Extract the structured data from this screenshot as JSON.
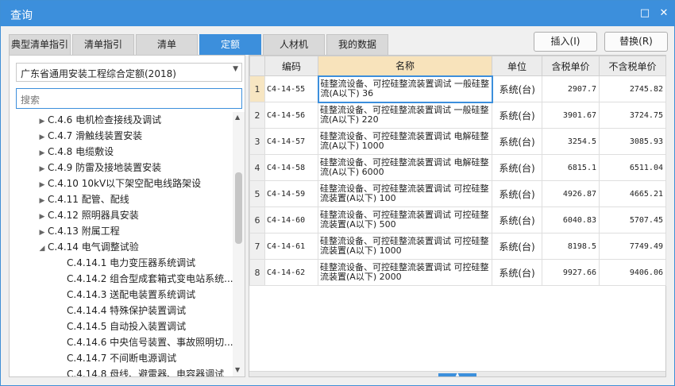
{
  "window": {
    "title": "查询",
    "minimize_glyph": "□",
    "close_glyph": "✕"
  },
  "tabs": [
    {
      "label": "典型清单指引",
      "active": false
    },
    {
      "label": "清单指引",
      "active": false
    },
    {
      "label": "清单",
      "active": false
    },
    {
      "label": "定额",
      "active": true
    },
    {
      "label": "人材机",
      "active": false
    },
    {
      "label": "我的数据",
      "active": false
    }
  ],
  "actions": {
    "insert_label": "插入(I)",
    "replace_label": "替换(R)"
  },
  "left": {
    "library": "广东省通用安装工程综合定额(2018)",
    "search_placeholder": "搜索",
    "tree": [
      {
        "label": "C.4.6 电机检查接线及调试",
        "level": 1,
        "toggle": "▶"
      },
      {
        "label": "C.4.7 滑触线装置安装",
        "level": 1,
        "toggle": "▶"
      },
      {
        "label": "C.4.8 电缆敷设",
        "level": 1,
        "toggle": "▶"
      },
      {
        "label": "C.4.9 防雷及接地装置安装",
        "level": 1,
        "toggle": "▶"
      },
      {
        "label": "C.4.10 10kV以下架空配电线路架设",
        "level": 1,
        "toggle": "▶"
      },
      {
        "label": "C.4.11 配管、配线",
        "level": 1,
        "toggle": "▶"
      },
      {
        "label": "C.4.12 照明器具安装",
        "level": 1,
        "toggle": "▶"
      },
      {
        "label": "C.4.13 附属工程",
        "level": 1,
        "toggle": "▶"
      },
      {
        "label": "C.4.14 电气调整试验",
        "level": 1,
        "toggle": "◢"
      },
      {
        "label": "C.4.14.1 电力变压器系统调试",
        "level": 2,
        "toggle": ""
      },
      {
        "label": "C.4.14.2 组合型成套箱式变电站系统...",
        "level": 2,
        "toggle": ""
      },
      {
        "label": "C.4.14.3 送配电装置系统调试",
        "level": 2,
        "toggle": ""
      },
      {
        "label": "C.4.14.4 特殊保护装置调试",
        "level": 2,
        "toggle": ""
      },
      {
        "label": "C.4.14.5 自动投入装置调试",
        "level": 2,
        "toggle": ""
      },
      {
        "label": "C.4.14.6 中央信号装置、事故照明切...",
        "level": 2,
        "toggle": ""
      },
      {
        "label": "C.4.14.7 不间断电源调试",
        "level": 2,
        "toggle": ""
      },
      {
        "label": "C.4.14.8 母线、避雷器、电容器调试",
        "level": 2,
        "toggle": ""
      }
    ]
  },
  "grid": {
    "columns": [
      "",
      "编码",
      "名称",
      "单位",
      "含税单价",
      "不含税单价"
    ],
    "rows": [
      {
        "n": "1",
        "code": "C4-14-55",
        "name": "硅整流设备、可控硅整流装置调试 一般硅整流(A以下) 36",
        "unit": "系统(台)",
        "tax": "2907.7",
        "notax": "2745.82"
      },
      {
        "n": "2",
        "code": "C4-14-56",
        "name": "硅整流设备、可控硅整流装置调试 一般硅整流(A以下) 220",
        "unit": "系统(台)",
        "tax": "3901.67",
        "notax": "3724.75"
      },
      {
        "n": "3",
        "code": "C4-14-57",
        "name": "硅整流设备、可控硅整流装置调试 电解硅整流(A以下) 1000",
        "unit": "系统(台)",
        "tax": "3254.5",
        "notax": "3085.93"
      },
      {
        "n": "4",
        "code": "C4-14-58",
        "name": "硅整流设备、可控硅整流装置调试 电解硅整流(A以下) 6000",
        "unit": "系统(台)",
        "tax": "6815.1",
        "notax": "6511.04"
      },
      {
        "n": "5",
        "code": "C4-14-59",
        "name": "硅整流设备、可控硅整流装置调试 可控硅整流装置(A以下) 100",
        "unit": "系统(台)",
        "tax": "4926.87",
        "notax": "4665.21"
      },
      {
        "n": "6",
        "code": "C4-14-60",
        "name": "硅整流设备、可控硅整流装置调试 可控硅整流装置(A以下) 500",
        "unit": "系统(台)",
        "tax": "6040.83",
        "notax": "5707.45"
      },
      {
        "n": "7",
        "code": "C4-14-61",
        "name": "硅整流设备、可控硅整流装置调试 可控硅整流装置(A以下) 1000",
        "unit": "系统(台)",
        "tax": "8198.5",
        "notax": "7749.49"
      },
      {
        "n": "8",
        "code": "C4-14-62",
        "name": "硅整流设备、可控硅整流装置调试 可控硅整流装置(A以下) 2000",
        "unit": "系统(台)",
        "tax": "9927.66",
        "notax": "9406.06"
      }
    ]
  }
}
